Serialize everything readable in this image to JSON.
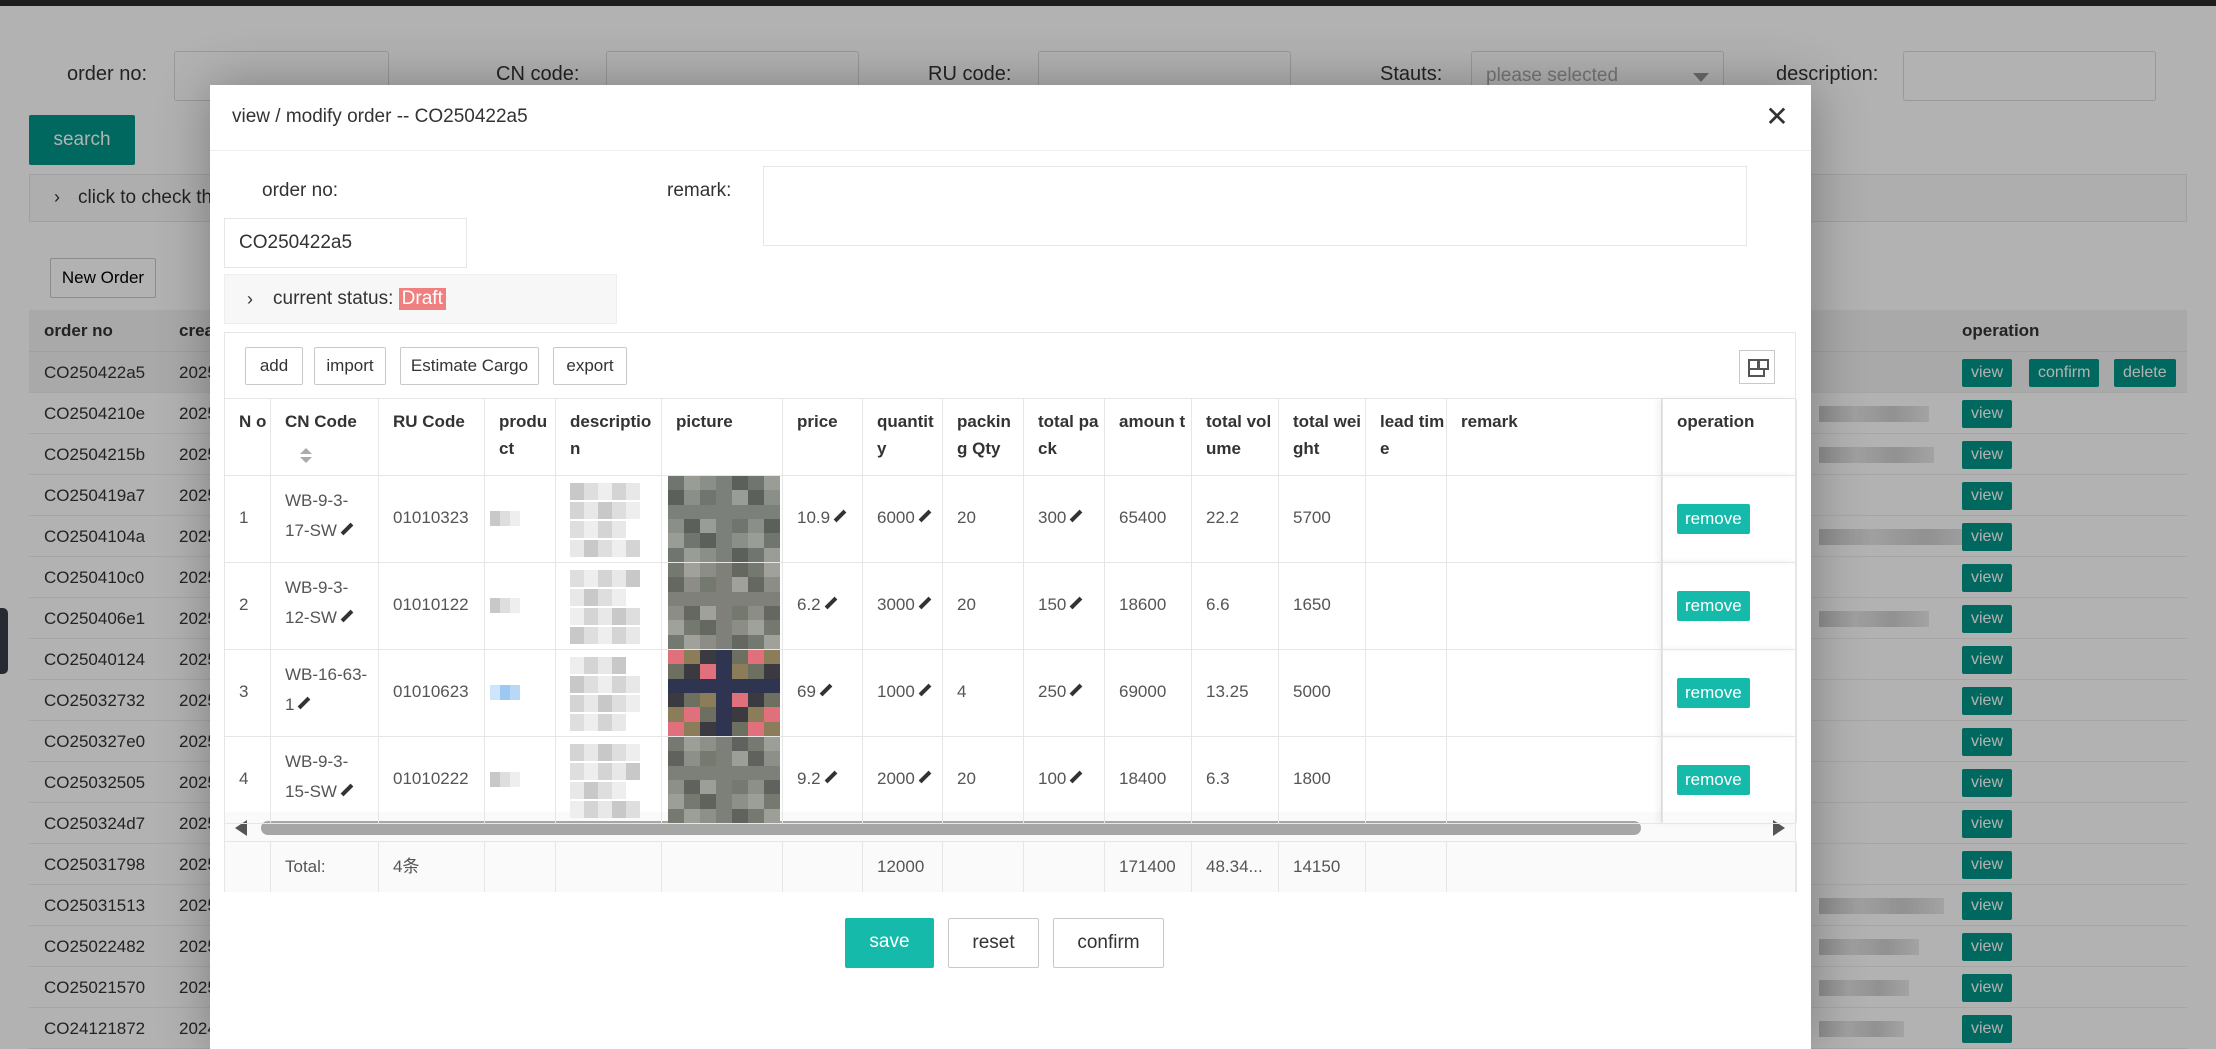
{
  "filters": {
    "order_no_label": "order no:",
    "cn_code_label": "CN code:",
    "ru_code_label": "RU code:",
    "status_label": "Stauts:",
    "status_placeholder": "please selected",
    "description_label": "description:",
    "search_label": "search"
  },
  "collapse_text": "click to check the",
  "new_order_label": "New Order",
  "bg_table": {
    "headers": {
      "order_no": "order no",
      "created": "crea",
      "operation": "operation"
    },
    "rows": [
      {
        "order_no": "CO250422a5",
        "year": "2025"
      },
      {
        "order_no": "CO2504210e",
        "year": "2025"
      },
      {
        "order_no": "CO2504215b",
        "year": "2025"
      },
      {
        "order_no": "CO250419a7",
        "year": "2025"
      },
      {
        "order_no": "CO2504104a",
        "year": "2025"
      },
      {
        "order_no": "CO250410c0",
        "year": "2025"
      },
      {
        "order_no": "CO250406e1",
        "year": "2025"
      },
      {
        "order_no": "CO25040124",
        "year": "2025"
      },
      {
        "order_no": "CO25032732",
        "year": "2025"
      },
      {
        "order_no": "CO250327e0",
        "year": "2025"
      },
      {
        "order_no": "CO25032505",
        "year": "2025"
      },
      {
        "order_no": "CO250324d7",
        "year": "2025"
      },
      {
        "order_no": "CO25031798",
        "year": "2025"
      },
      {
        "order_no": "CO25031513",
        "year": "2025"
      },
      {
        "order_no": "CO25022482",
        "year": "2025"
      },
      {
        "order_no": "CO25021570",
        "year": "2025"
      },
      {
        "order_no": "CO24121872",
        "year": "2024"
      }
    ],
    "view_label": "view",
    "confirm_label": "confirm",
    "delete_label": "delete"
  },
  "modal": {
    "title": "view / modify order -- CO250422a5",
    "close_icon": "close-icon",
    "order_no_label": "order no:",
    "order_no_value": "CO250422a5",
    "remark_label": "remark:",
    "remark_value": "",
    "status_label": "current status:",
    "status_value": "Draft",
    "status_color": "#f08080",
    "toolbar": {
      "add": "add",
      "import": "import",
      "estimate": "Estimate Cargo",
      "export": "export"
    },
    "columns": {
      "no": "N o",
      "cn_code": "CN Code",
      "ru_code": "RU Code",
      "product": "produ ct",
      "description": "descriptio n",
      "picture": "picture",
      "price": "price",
      "quantity": "quantit y",
      "packing_qty": "packin g Qty",
      "total_pack": "total pack",
      "amount": "amoun t",
      "total_volume": "total volume",
      "total_weight": "total weight",
      "lead_time": "lead time",
      "remark": "remark",
      "operation": "operation"
    },
    "rows": [
      {
        "no": "1",
        "cn1": "WB-9-3-",
        "cn2": "17-SW",
        "ru": "01010323",
        "price": "10.9",
        "quantity": "6000",
        "packing": "20",
        "pack": "300",
        "amount": "65400",
        "volume": "22.2",
        "weight": "5700"
      },
      {
        "no": "2",
        "cn1": "WB-9-3-",
        "cn2": "12-SW",
        "ru": "01010122",
        "price": "6.2",
        "quantity": "3000",
        "packing": "20",
        "pack": "150",
        "amount": "18600",
        "volume": "6.6",
        "weight": "1650"
      },
      {
        "no": "3",
        "cn1": "WB-16-63-",
        "cn2": "1",
        "ru": "01010623",
        "price": "69",
        "quantity": "1000",
        "packing": "4",
        "pack": "250",
        "amount": "69000",
        "volume": "13.25",
        "weight": "5000"
      },
      {
        "no": "4",
        "cn1": "WB-9-3-",
        "cn2": "15-SW",
        "ru": "01010222",
        "price": "9.2",
        "quantity": "2000",
        "packing": "20",
        "pack": "100",
        "amount": "18400",
        "volume": "6.3",
        "weight": "1800"
      }
    ],
    "remove_label": "remove",
    "total": {
      "label": "Total:",
      "count": "4条",
      "quantity": "12000",
      "amount": "171400",
      "volume": "48.34...",
      "weight": "14150"
    },
    "footer": {
      "save": "save",
      "reset": "reset",
      "confirm": "confirm"
    },
    "accent_color": "#16baaa"
  }
}
